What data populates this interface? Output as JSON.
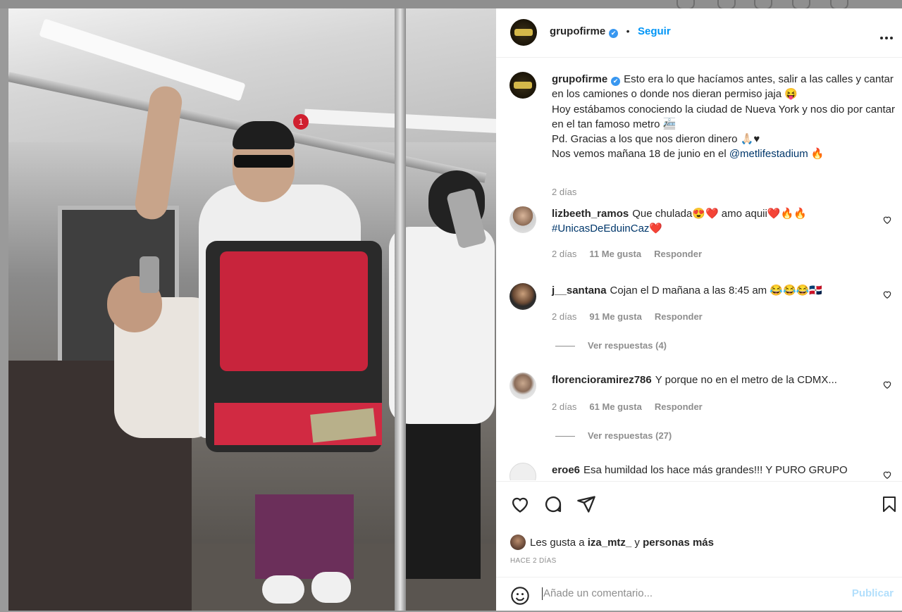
{
  "post": {
    "username": "grupofirme",
    "verified_badge": "✔",
    "separator": "•",
    "follow_label": "Seguir",
    "more_icon": "more-options-icon"
  },
  "caption": {
    "username": "grupofirme",
    "line1": "Esto era lo que hacíamos antes, salir a las calles y cantar en los camiones o donde nos dieran permiso jaja 😝",
    "line2": "Hoy estábamos conociendo la ciudad de Nueva York y nos dio por cantar en el tan famoso metro 🚈",
    "line3": "Pd. Gracias a los que nos dieron dinero 🙏🏻♥",
    "line4_pre": "Nos vemos mañana 18 de junio en el ",
    "line4_link": "@metlifestadium",
    "line4_post": " 🔥",
    "time": "2 días"
  },
  "comments": [
    {
      "username": "lizbeeth_ramos",
      "text": "Que chulada😍❤️ amo aquii❤️🔥🔥",
      "hashtag": "#UnicasDeEduinCaz",
      "hashtag_suffix": "❤️",
      "time": "2 días",
      "likes": "11 Me gusta",
      "reply": "Responder"
    },
    {
      "username": "j__santana",
      "text": "Cojan el D mañana a las 8:45 am 😂😂😂🇩🇴",
      "time": "2 días",
      "likes": "91 Me gusta",
      "reply": "Responder",
      "view_replies": "Ver respuestas (4)"
    },
    {
      "username": "florencioramirez786",
      "text": "Y porque no en el metro de la CDMX...",
      "time": "2 días",
      "likes": "61 Me gusta",
      "reply": "Responder",
      "view_replies": "Ver respuestas (27)"
    },
    {
      "username": "eroe6",
      "text": "Esa humildad los hace más grandes!!! Y PURO GRUPO"
    }
  ],
  "actions": {
    "liked_prefix": "Les gusta a ",
    "liked_user": "iza_mtz_",
    "liked_mid": " y ",
    "liked_others": "personas más",
    "timestamp": "HACE 2 DÍAS"
  },
  "comment_box": {
    "placeholder": "Añade un comentario...",
    "submit": "Publicar",
    "emoji_icon": "emoji-icon"
  },
  "colors": {
    "accent": "#0095f6",
    "link": "#00376b",
    "muted": "#8e8e8e",
    "publicar_disabled": "#b2dffc"
  }
}
